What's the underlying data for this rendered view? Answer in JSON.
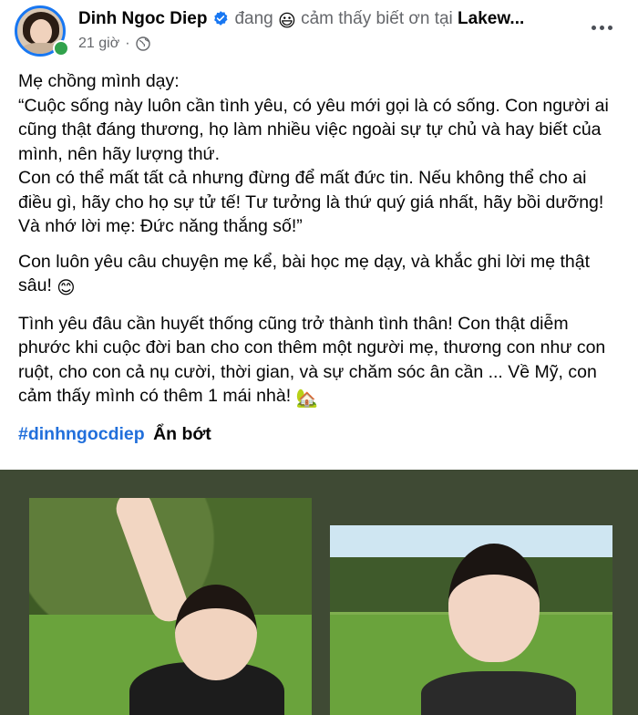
{
  "post": {
    "author": "Dinh Ngoc Diep",
    "status_prefix": "đang",
    "status_emoji": "😃",
    "status_text": "cảm thấy biết ơn tại",
    "location": "Lakew...",
    "time": "21 giờ",
    "separator": "·",
    "icons": {
      "verified": "verified-badge-icon",
      "audience": "globe-icon",
      "more": "more-options-icon"
    },
    "colors": {
      "verified": "#1877f2",
      "hashtag": "#216fdb",
      "online": "#31a24c"
    }
  },
  "body": {
    "p1": "Mẹ chồng mình dạy:",
    "p2": "“Cuộc sống này luôn cần tình yêu, có yêu mới gọi là có sống. Con người ai cũng thật đáng thương, họ làm nhiều việc ngoài sự tự chủ và hay biết của mình, nên hãy lượng thứ.",
    "p3": "Con có thể mất tất cả nhưng đừng để mất đức tin. Nếu không thể cho ai điều gì, hãy cho họ sự tử tế! Tư tưởng là thứ quý giá nhất, hãy bồi dưỡng! Và nhớ lời mẹ: Đức năng thắng số!”",
    "p4": "Con luôn yêu câu chuyện mẹ kể, bài học mẹ dạy, và khắc ghi lời mẹ thật sâu!",
    "p4_emoji": "😊",
    "p5": "Tình yêu đâu cần huyết thống cũng trở thành tình thân! Con thật diễm phước khi cuộc đời ban cho con thêm một người mẹ, thương con như con ruột, cho con cả nụ cười, thời gian, và sự chăm sóc ân cần ... Về Mỹ, con cảm thấy mình có thêm 1 mái nhà!",
    "p5_emoji": "🏡",
    "hashtag": "#dinhngocdiep",
    "see_less": "Ẩn bớt"
  }
}
